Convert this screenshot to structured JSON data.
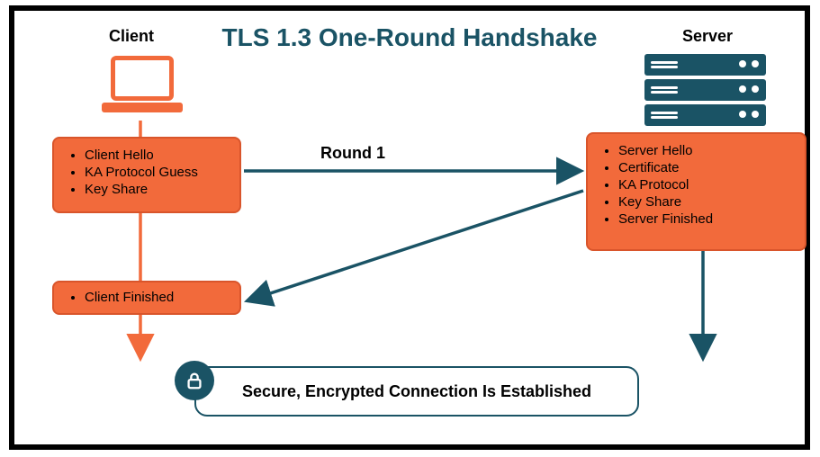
{
  "title": "TLS 1.3 One-Round Handshake",
  "client_label": "Client",
  "server_label": "Server",
  "round_label": "Round 1",
  "client_step1": {
    "items": [
      "Client Hello",
      "KA Protocol Guess",
      "Key Share"
    ]
  },
  "client_step2": {
    "items": [
      "Client Finished"
    ]
  },
  "server_step": {
    "items": [
      "Server Hello",
      "Certificate",
      "KA Protocol",
      "Key Share",
      "Server Finished"
    ]
  },
  "secure_text": "Secure, Encrypted Connection Is Established",
  "colors": {
    "orange": "#f26a3b",
    "teal": "#1a5365"
  }
}
